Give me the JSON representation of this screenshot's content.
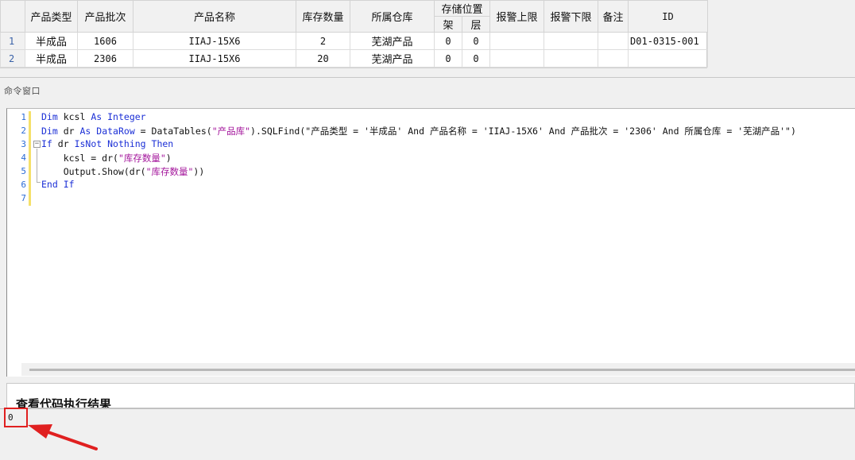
{
  "grid": {
    "headers": {
      "product_type": "产品类型",
      "batch": "产品批次",
      "product_name": "产品名称",
      "stock_qty": "库存数量",
      "warehouse": "所属仓库",
      "storage_location": "存储位置",
      "shelf": "架",
      "layer": "层",
      "alarm_upper": "报警上限",
      "alarm_lower": "报警下限",
      "remark": "备注",
      "id": "ID"
    },
    "rows": [
      {
        "num": "1",
        "product_type": "半成品",
        "batch": "1606",
        "product_name": "IIAJ-15X6",
        "stock_qty": "2",
        "warehouse": "芜湖产品",
        "shelf": "0",
        "layer": "0",
        "alarm_upper": "",
        "alarm_lower": "",
        "remark": "",
        "id": "D01-0315-001"
      },
      {
        "num": "2",
        "product_type": "半成品",
        "batch": "2306",
        "product_name": "IIAJ-15X6",
        "stock_qty": "20",
        "warehouse": "芜湖产品",
        "shelf": "0",
        "layer": "0",
        "alarm_upper": "",
        "alarm_lower": "",
        "remark": "",
        "id": ""
      }
    ]
  },
  "command_window": {
    "title": "命令窗口",
    "line_numbers": [
      "1",
      "2",
      "3",
      "4",
      "5",
      "6",
      "7"
    ],
    "code": {
      "l1": {
        "kw1": "Dim",
        "a": " kcsl ",
        "kw2": "As",
        "b": " ",
        "kw3": "Integer"
      },
      "l2": {
        "kw1": "Dim",
        "a": " dr ",
        "kw2": "As",
        "b": " ",
        "kw3": "DataRow",
        "c": " = DataTables(",
        "s1": "\"产品库\"",
        "d": ").SQLFind(\"产品类型 = '半成品' And 产品名称 = 'IIAJ-15X6' And 产品批次 = '2306' And 所属仓库 = '芜湖产品'\")"
      },
      "l3": {
        "kw1": "If",
        "a": " dr ",
        "kw2": "IsNot",
        "b": " ",
        "kw3": "Nothing",
        "c": " ",
        "kw4": "Then"
      },
      "l4": {
        "a": "    kcsl = dr(",
        "s1": "\"库存数量\"",
        "b": ")"
      },
      "l5": {
        "a": "    Output.Show(dr(",
        "s1": "\"库存数量\"",
        "b": "))"
      },
      "l6": {
        "kw1": "End",
        "a": " ",
        "kw2": "If"
      }
    }
  },
  "result": {
    "heading": "查看代码执行结果",
    "output_value": "0"
  },
  "annotation": {
    "box_color": "#e02020",
    "arrow_color": "#e02020"
  }
}
